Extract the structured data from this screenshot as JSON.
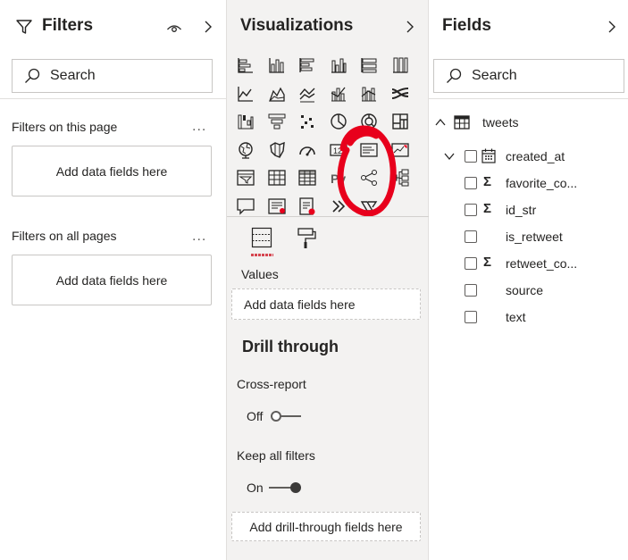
{
  "filters": {
    "title": "Filters",
    "search_placeholder": "Search",
    "section_page": "Filters on this page",
    "section_all": "Filters on all pages",
    "more": "...",
    "dropzone_page": "Add data fields here",
    "dropzone_all": "Add data fields here"
  },
  "visualizations": {
    "title": "Visualizations",
    "icons": [
      "stacked-bar-chart-icon",
      "stacked-column-chart-icon",
      "clustered-bar-chart-icon",
      "clustered-column-chart-icon",
      "100-stacked-bar-chart-icon",
      "100-stacked-column-chart-icon",
      "line-chart-icon",
      "area-chart-icon",
      "stacked-area-chart-icon",
      "line-clustered-column-icon",
      "line-stacked-column-icon",
      "ribbon-chart-icon",
      "waterfall-chart-icon",
      "funnel-chart-icon",
      "scatter-chart-icon",
      "pie-chart-icon",
      "donut-chart-icon",
      "treemap-icon",
      "map-icon",
      "filled-map-icon",
      "gauge-icon",
      "card-icon",
      "multi-row-card-icon",
      "kpi-icon",
      "slicer-icon",
      "table-icon",
      "matrix-icon",
      "python-visual-icon",
      "key-influencers-icon",
      "decomposition-tree-icon",
      "qa-icon",
      "smart-narrative-icon",
      "paginated-report-icon",
      "power-apps-icon",
      "power-automate-icon"
    ],
    "python_label": "Py",
    "tab_fields_icon": "build-visual-icon",
    "tab_format_icon": "format-paint-roller-icon",
    "values_label": "Values",
    "values_dropzone": "Add data fields here",
    "drill_title": "Drill through",
    "cross_report_label": "Cross-report",
    "cross_report_state": "Off",
    "keep_filters_label": "Keep all filters",
    "keep_filters_state": "On",
    "drill_dropzone": "Add drill-through fields here"
  },
  "fields": {
    "title": "Fields",
    "search_placeholder": "Search",
    "table_name": "tweets",
    "items": [
      {
        "name": "created_at",
        "icon": "calendar-icon"
      },
      {
        "name": "favorite_co...",
        "icon": "sigma-icon"
      },
      {
        "name": "id_str",
        "icon": "sigma-icon"
      },
      {
        "name": "is_retweet",
        "icon": ""
      },
      {
        "name": "retweet_co...",
        "icon": "sigma-icon"
      },
      {
        "name": "source",
        "icon": ""
      },
      {
        "name": "text",
        "icon": ""
      }
    ]
  },
  "colors": {
    "annotation": "#e8001c",
    "accent_underline": "#d64550",
    "pane_gray": "#f3f2f1"
  }
}
